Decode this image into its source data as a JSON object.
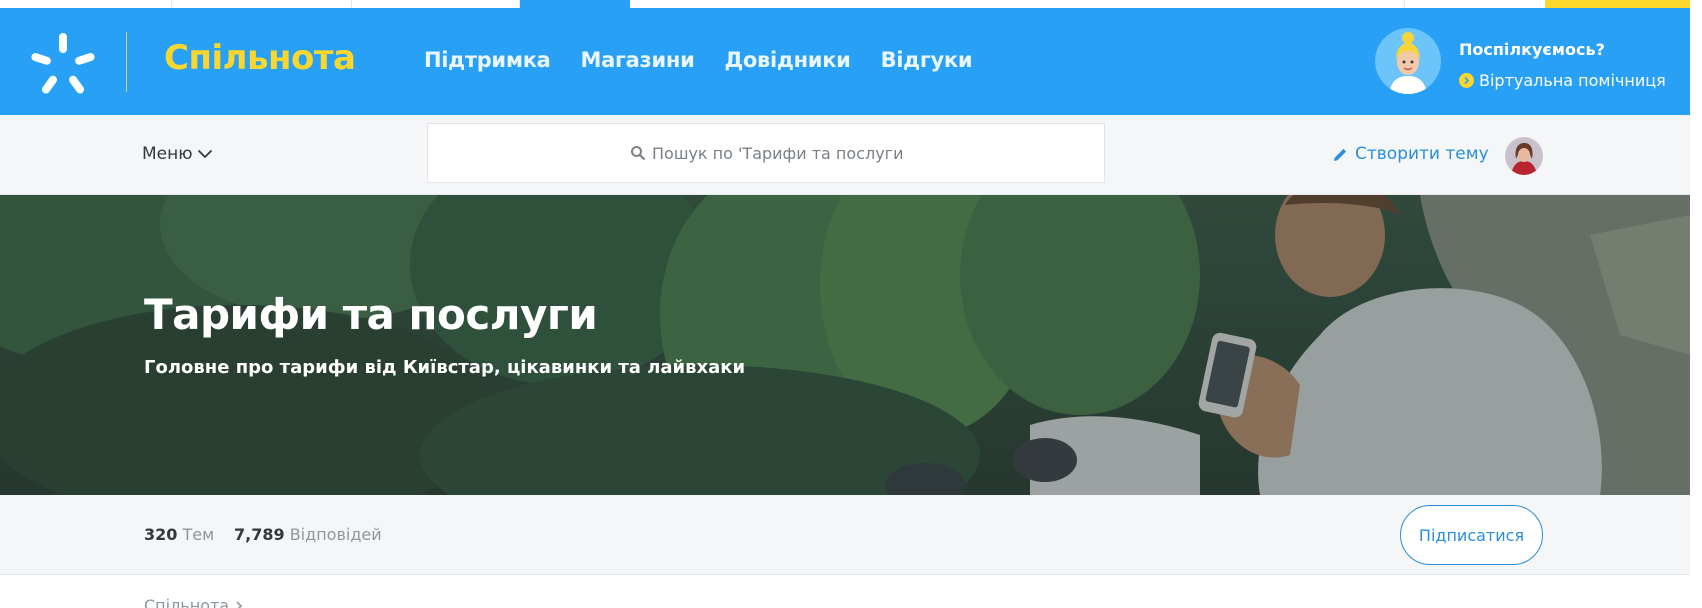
{
  "header": {
    "brand": "Спільнота",
    "nav": [
      {
        "label": "Підтримка"
      },
      {
        "label": "Магазини"
      },
      {
        "label": "Довідники"
      },
      {
        "label": "Відгуки"
      }
    ],
    "assistant": {
      "title": "Поспілкуємось?",
      "link": "Віртуальна помічниця"
    }
  },
  "subbar": {
    "menu_label": "Меню",
    "search_placeholder": "Пошук по 'Тарифи та послуги'",
    "create_topic": "Створити тему"
  },
  "hero": {
    "title": "Тарифи та послуги",
    "subtitle": "Головне про тарифи від Київстар, цікавинки та лайвхаки"
  },
  "stats": {
    "topics_count": "320",
    "topics_label": "Тем",
    "replies_count": "7,789",
    "replies_label": "Відповідей",
    "subscribe_label": "Підписатися"
  },
  "breadcrumb": {
    "root": "Спільнота"
  },
  "colors": {
    "header_blue": "#28a0f5",
    "brand_yellow": "#fbd72e",
    "link_blue": "#2a8fd8"
  }
}
